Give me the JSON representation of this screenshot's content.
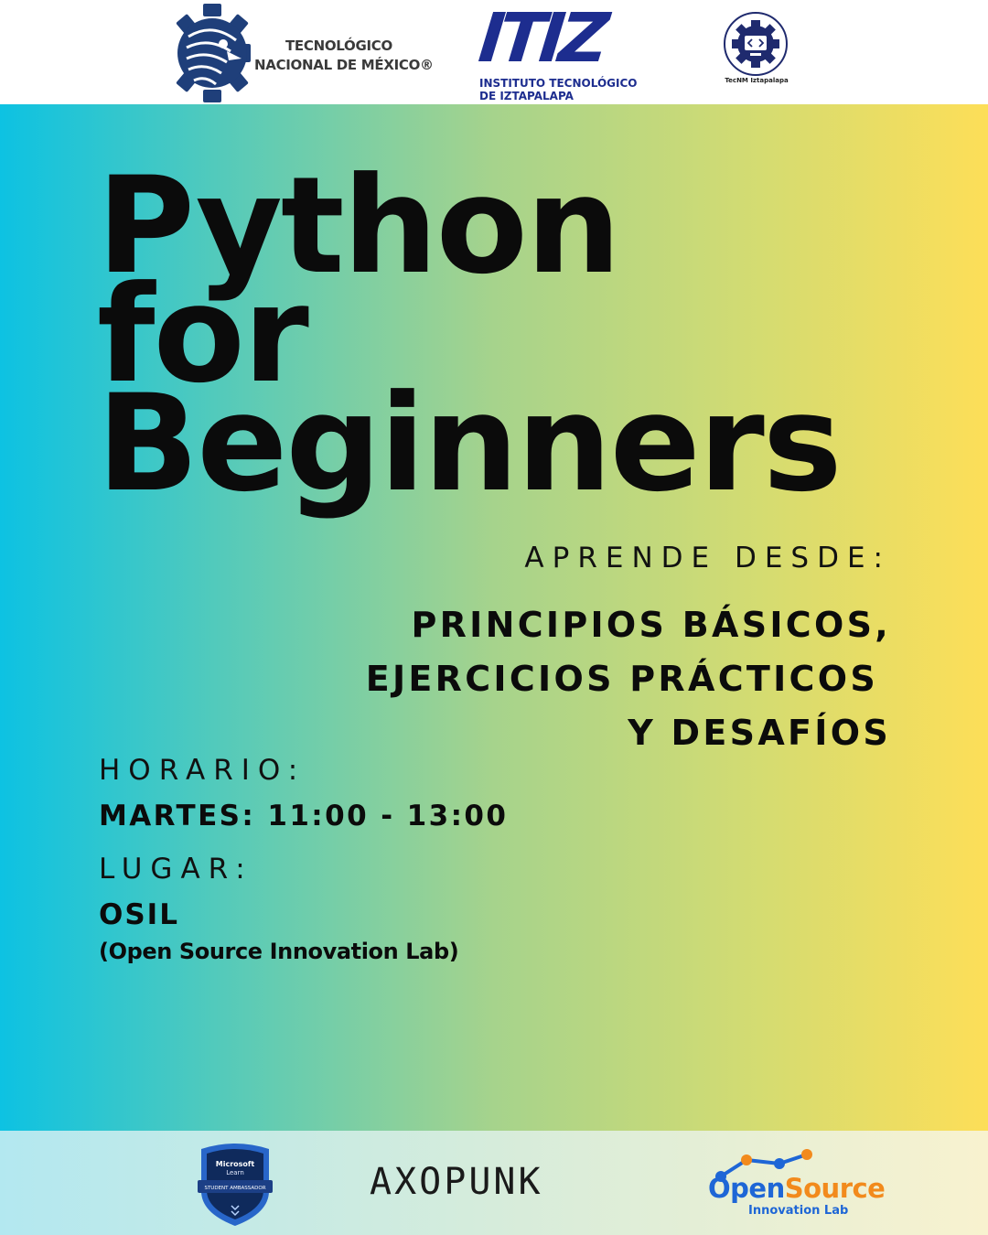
{
  "header": {
    "tecnm_line1": "TECNOLÓGICO",
    "tecnm_line2": "NACIONAL DE MÉXICO®",
    "itiz_word": "ITIZ",
    "itiz_line1": "INSTITUTO TECNOLÓGICO",
    "itiz_line2": "DE IZTAPALAPA",
    "isc_caption": "TecNM Iztapalapa"
  },
  "title": {
    "line1": "Python",
    "line2": "for",
    "line3": "Beginners"
  },
  "aprende": {
    "label": "APRENDE DESDE:",
    "topic1": "PRINCIPIOS BÁSICOS,",
    "topic2": "EJERCICIOS PRÁCTICOS",
    "topic3": "Y DESAFÍOS"
  },
  "horario": {
    "label": "HORARIO:",
    "value": "MARTES: 11:00 - 13:00"
  },
  "lugar": {
    "label": "LUGAR:",
    "value": "OSIL",
    "detail": "(Open Source Innovation Lab)"
  },
  "footer": {
    "mlsa_line1": "Microsoft",
    "mlsa_line2": "Learn",
    "mlsa_line3": "STUDENT AMBASSADOR",
    "axo": "AXOPUNK",
    "os_open": "Open",
    "os_source": "Source",
    "os_sub": "Innovation Lab"
  },
  "colors": {
    "gradient_left": "#0dc2e2",
    "gradient_right": "#fdde58",
    "text": "#0b0b0b",
    "itiz_blue": "#1d2d8f",
    "os_blue": "#1e66d6",
    "os_orange": "#f28a1c"
  },
  "icons": [
    "tecnm-eagle-gear-icon",
    "isc-gear-icon",
    "mlsa-shield-icon",
    "opensource-network-icon"
  ]
}
